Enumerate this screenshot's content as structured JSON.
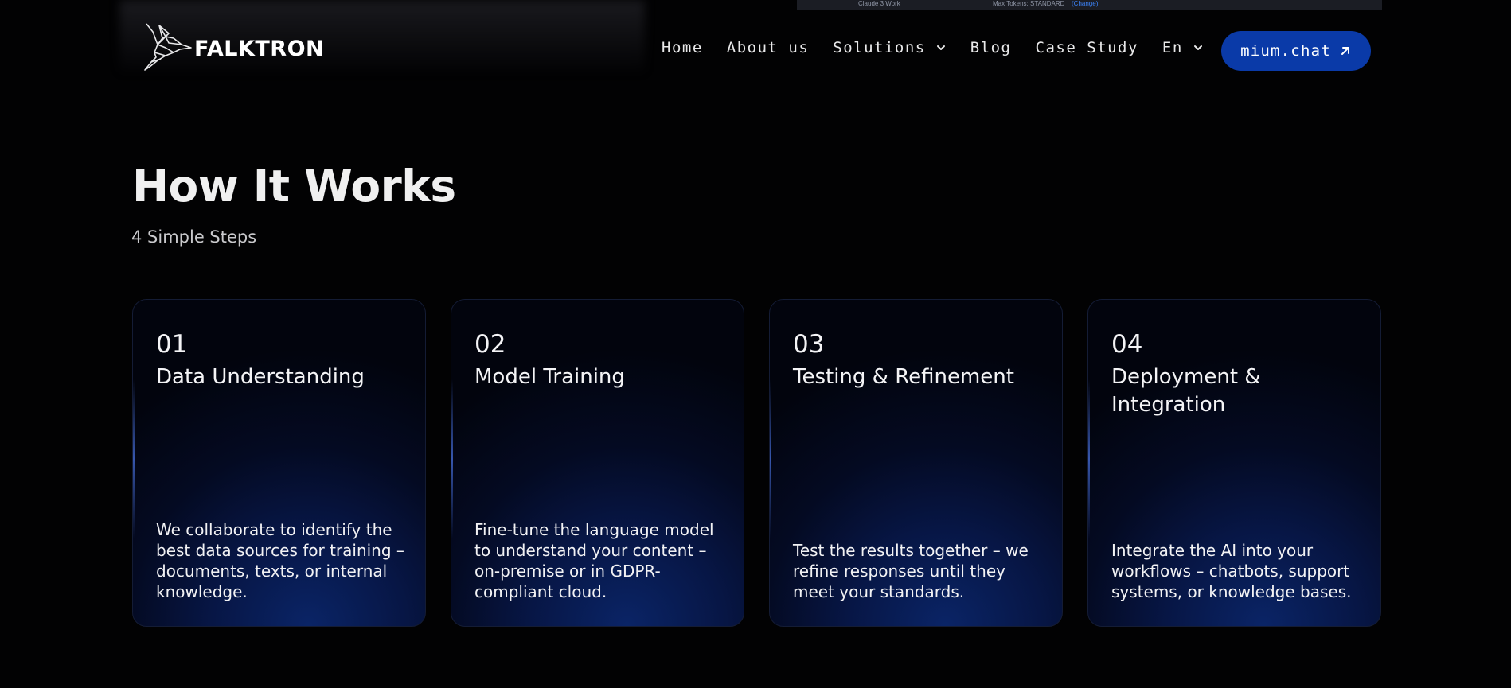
{
  "header": {
    "brand": "FALKTRON",
    "nav": [
      {
        "label": "Home"
      },
      {
        "label": "About us"
      },
      {
        "label": "Solutions",
        "icon": "chevron-down-icon"
      },
      {
        "label": "Blog"
      },
      {
        "label": "Case Study"
      },
      {
        "label": "En",
        "icon": "chevron-down-icon"
      }
    ],
    "cta": {
      "label": "mium.chat",
      "icon": "arrow-up-right-icon",
      "color": "#0a3aa8"
    }
  },
  "background_peek": {
    "left_text": "Claude 3 Work",
    "right_text": "Max Tokens: STANDARD",
    "right_link": "(Change)"
  },
  "section": {
    "title": "How It Works",
    "subtitle": "4 Simple Steps"
  },
  "steps": [
    {
      "number": "01",
      "title": "Data Understanding",
      "description": "We collaborate to identify the best data sources for training – documents, texts, or internal knowledge."
    },
    {
      "number": "02",
      "title": "Model Training",
      "description": "Fine-tune the language model to understand your content – on-premise or in GDPR-compliant cloud."
    },
    {
      "number": "03",
      "title": "Testing & Refinement",
      "description": "Test the results together – we refine responses until they meet your standards."
    },
    {
      "number": "04",
      "title": "Deployment & Integration",
      "description": "Integrate the AI into your workflows – chatbots, support systems, or knowledge bases."
    }
  ],
  "colors": {
    "background": "#020203",
    "accent": "#0a3aa8",
    "card_glow": "#0a2466"
  }
}
